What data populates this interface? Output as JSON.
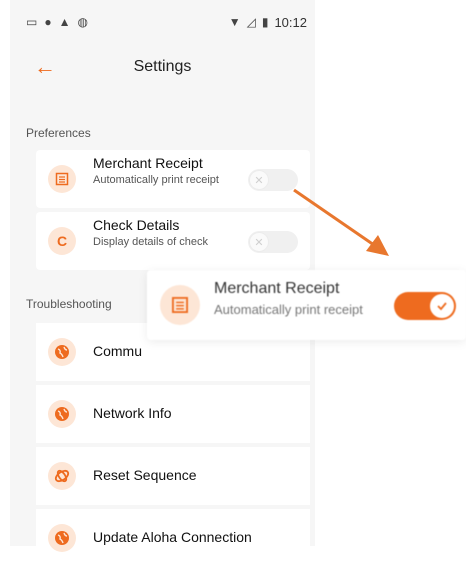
{
  "status_bar": {
    "time": "10:12"
  },
  "header": {
    "title": "Settings"
  },
  "preferences": {
    "label": "Preferences",
    "items": [
      {
        "title": "Merchant Receipt",
        "subtitle": "Automatically print receipt",
        "toggle_on": false
      },
      {
        "title": "Check Details",
        "subtitle": "Display details of check",
        "toggle_on": false,
        "icon_letter": "C"
      }
    ]
  },
  "troubleshooting": {
    "label": "Troubleshooting",
    "items": [
      {
        "label": "Commu"
      },
      {
        "label": "Network Info"
      },
      {
        "label": "Reset Sequence"
      },
      {
        "label": "Update Aloha Connection"
      }
    ]
  },
  "zoom_callout": {
    "title": "Merchant Receipt",
    "subtitle": "Automatically print receipt",
    "toggle_on": true
  },
  "colors": {
    "accent": "#ee6b1f",
    "icon_bg": "#fde6d6",
    "screen_bg": "#f6f6f6"
  }
}
